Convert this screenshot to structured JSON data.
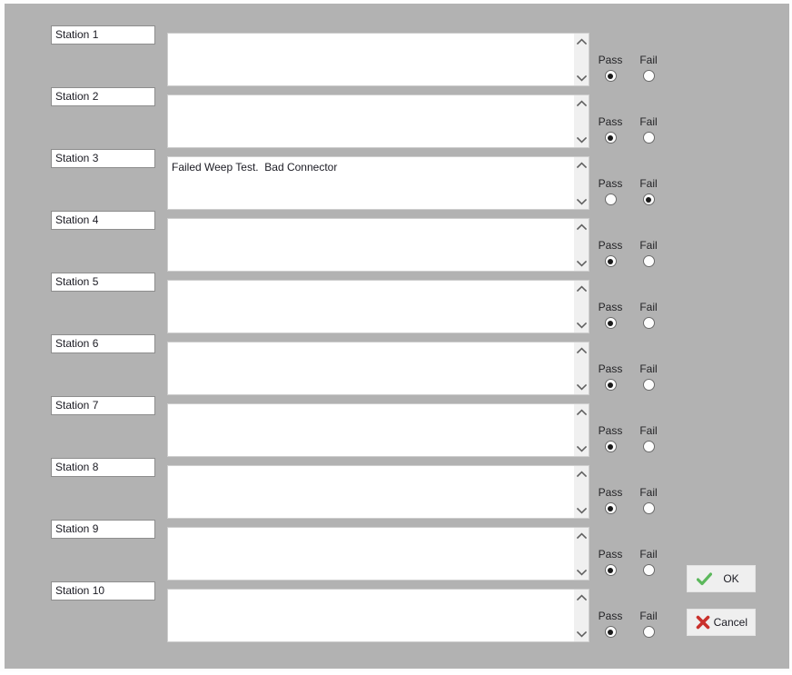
{
  "window": {
    "background_color": "#b2b2b2",
    "frame_color": "#fdfdfd"
  },
  "labels": {
    "pass": "Pass",
    "fail": "Fail"
  },
  "notes_placeholder": "",
  "rows": [
    {
      "station": "Station 1",
      "notes": "",
      "pass_checked": true,
      "fail_checked": false
    },
    {
      "station": "Station 2",
      "notes": "",
      "pass_checked": true,
      "fail_checked": false
    },
    {
      "station": "Station 3",
      "notes": "Failed Weep Test.  Bad Connector",
      "pass_checked": false,
      "fail_checked": true
    },
    {
      "station": "Station 4",
      "notes": "",
      "pass_checked": true,
      "fail_checked": false
    },
    {
      "station": "Station 5",
      "notes": "",
      "pass_checked": true,
      "fail_checked": false
    },
    {
      "station": "Station 6",
      "notes": "",
      "pass_checked": true,
      "fail_checked": false
    },
    {
      "station": "Station 7",
      "notes": "",
      "pass_checked": true,
      "fail_checked": false
    },
    {
      "station": "Station 8",
      "notes": "",
      "pass_checked": true,
      "fail_checked": false
    },
    {
      "station": "Station 9",
      "notes": "",
      "pass_checked": true,
      "fail_checked": false
    },
    {
      "station": "Station 10",
      "notes": "",
      "pass_checked": true,
      "fail_checked": false
    }
  ],
  "buttons": {
    "ok": {
      "label": "OK",
      "icon": "check-mark-icon",
      "icon_color": "#5cb85c"
    },
    "cancel": {
      "label": "Cancel",
      "icon": "cross-mark-icon",
      "icon_color": "#c9302c"
    }
  },
  "scrollbar": {
    "up_icon": "chevron-up-icon",
    "down_icon": "chevron-down-icon",
    "track_color": "#f0f0f0",
    "arrow_color": "#606060"
  }
}
